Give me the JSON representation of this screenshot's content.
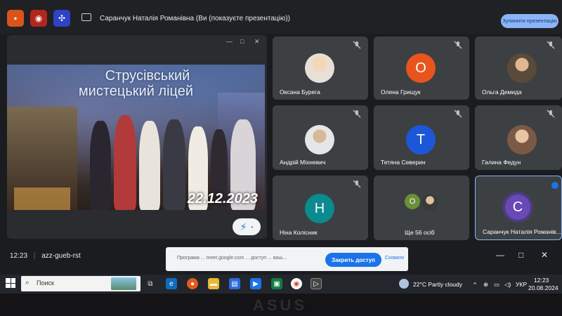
{
  "topbar": {
    "presentation_title": "Саранчук Наталія Романівна (Ви (показуєте презентацію))",
    "stop_button": "Зупинити презентацію",
    "colors": {
      "stop_bg": "#8ab4f8",
      "btn1": "#d9541b",
      "btn2": "#b3261e",
      "btn3": "#2f43c4"
    }
  },
  "main": {
    "slide_title_line1": "Струсівський",
    "slide_title_line2": "мистецький ліцей",
    "slide_date": "22.12.2023"
  },
  "tiles": [
    {
      "name": "Оксана Бурега",
      "type": "photo"
    },
    {
      "name": "Олена Грищук",
      "initial": "О",
      "color": "#e8541e"
    },
    {
      "name": "Ольга Демида",
      "type": "photo"
    },
    {
      "name": "Андрій Міхневич",
      "type": "photo"
    },
    {
      "name": "Тетяна Северин",
      "initial": "Т",
      "color": "#1d57d9"
    },
    {
      "name": "Галина Федун",
      "type": "photo"
    },
    {
      "name": "Ніна Колісник",
      "initial": "Н",
      "color": "#0b8a8f"
    },
    {
      "name": "Ще 56 осіб",
      "initial": "О",
      "color": "#6b8f3a"
    },
    {
      "name": "Саранчук Наталія Романів...",
      "initial": "С",
      "color": "#6949b8"
    }
  ],
  "meeting": {
    "time": "12:23",
    "code": "azz-gueb-rst"
  },
  "notice": {
    "text": "Програма ... meet.google.com ... доступ ... ваш...",
    "button": "Закрить доступ",
    "link": "Сховати"
  },
  "taskbar": {
    "search_placeholder": "Поиск",
    "weather": "22°C  Partly cloudy",
    "lang": "УКР",
    "time": "12:23",
    "date": "20.08.2024"
  }
}
